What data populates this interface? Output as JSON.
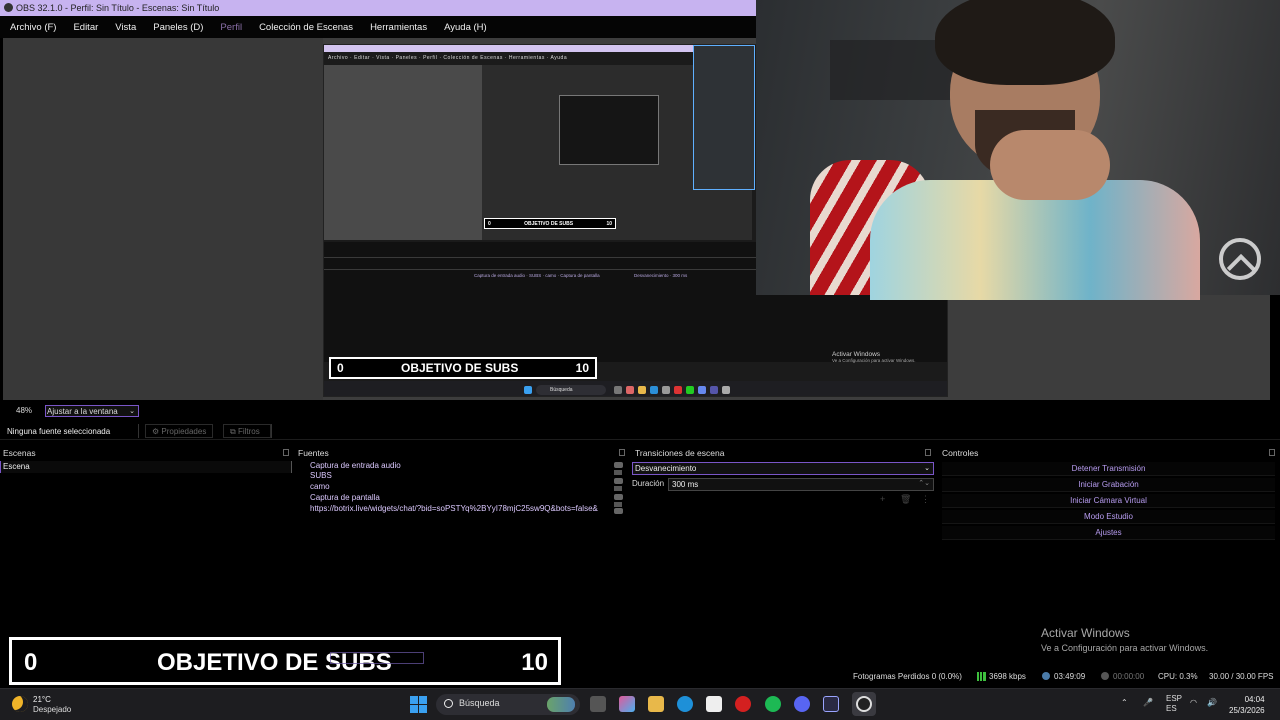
{
  "window": {
    "title": "OBS 32.1.0 - Perfil: Sin Título - Escenas: Sin Título"
  },
  "menu": [
    "Archivo (F)",
    "Editar",
    "Vista",
    "Paneles (D)",
    "Perfil",
    "Colección de Escenas",
    "Herramientas",
    "Ayuda (H)"
  ],
  "preview": {
    "program_banner": {
      "left": "0",
      "center": "OBJETIVO DE SUBS",
      "right": "10"
    },
    "mini_banner": {
      "left": "0",
      "center": "OBJETIVO DE SUBS",
      "right": "10"
    },
    "search_label": "Búsqueda",
    "activate_title": "Activar Windows",
    "activate_sub": "Ve a Configuración para activar Windows."
  },
  "zoom": {
    "value": "48%",
    "mode": "Ajustar a la ventana"
  },
  "source_bar": {
    "none_selected": "Ninguna fuente seleccionada",
    "properties": "Propiedades",
    "filters": "Filtros"
  },
  "docks": {
    "scenes": {
      "title": "Escenas",
      "items": [
        "Escena"
      ]
    },
    "sources": {
      "title": "Fuentes",
      "items": [
        "Captura de entrada audio",
        "SUBS",
        "camo",
        "Captura de pantalla",
        "https://botrix.live/widgets/chat/?bid=soPSTYq%2BYyI78mjC25sw9Q&bots=false&"
      ]
    },
    "transitions": {
      "title": "Transiciones de escena",
      "selected": "Desvanecimiento",
      "duration_label": "Duración",
      "duration_value": "300 ms"
    },
    "controls": {
      "title": "Controles",
      "buttons": [
        "Detener Transmisión",
        "Iniciar Grabación",
        "Iniciar Cámara Virtual",
        "Modo Estudio",
        "Ajustes"
      ]
    }
  },
  "overlay_banner": {
    "left": "0",
    "center": "OBJETIVO DE SUBS",
    "right": "10"
  },
  "activate_windows": {
    "title": "Activar Windows",
    "subtitle": "Ve a Configuración para activar Windows."
  },
  "status": {
    "dropped_frames": "Fotogramas Perdidos 0 (0.0%)",
    "bitrate": "3698 kbps",
    "stream_time": "03:49:09",
    "rec_time": "00:00:00",
    "cpu": "CPU: 0.3%",
    "fps": "30.00 / 30.00 FPS"
  },
  "taskbar": {
    "weather_temp": "21°C",
    "weather_desc": "Despejado",
    "search": "Búsqueda",
    "lang_top": "ESP",
    "lang_bottom": "ES",
    "time": "04:04",
    "date": "25/3/2026"
  },
  "colors": {
    "accent": "#7a56c8",
    "titlebar": "#c7b3f0",
    "control_text": "#b79cf0"
  }
}
